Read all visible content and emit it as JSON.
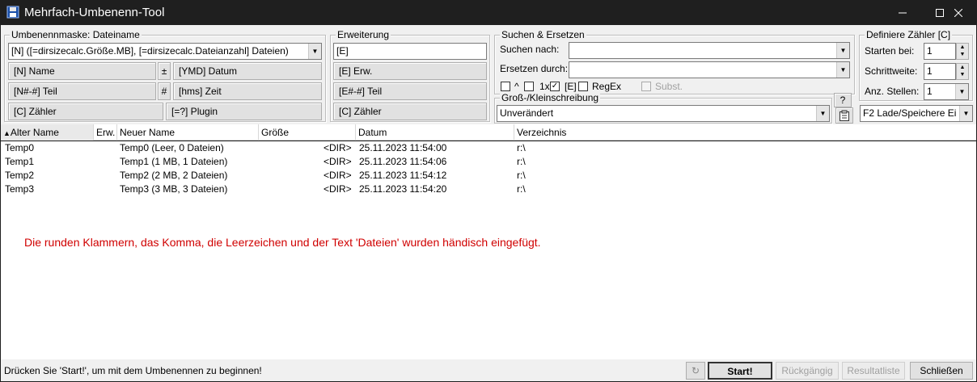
{
  "window": {
    "title": "Mehrfach-Umbenenn-Tool",
    "minimize": "—",
    "maximize": "☐",
    "close": "✕"
  },
  "mask": {
    "legend": "Umbenennmaske: Dateiname",
    "value": "[N] ([=dirsizecalc.Größe.MB], [=dirsizecalc.Dateianzahl] Dateien)",
    "btn_name": "[N]  Name",
    "btn_plusminus": "±",
    "btn_date": "[YMD]  Datum",
    "btn_part": "[N#-#] Teil",
    "btn_hash": "#",
    "btn_time": "[hms]  Zeit",
    "btn_counter": "[C]  Zähler",
    "btn_plugin": "[=?]  Plugin"
  },
  "extension": {
    "legend": "Erweiterung",
    "value": "[E]",
    "btn_ext": "[E]  Erw.",
    "btn_part": "[E#-#] Teil",
    "btn_counter": "[C]  Zähler"
  },
  "search": {
    "legend": "Suchen & Ersetzen",
    "find_label": "Suchen nach:",
    "find_value": "",
    "replace_label": "Ersetzen durch:",
    "replace_value": "",
    "opt_caret": "^",
    "opt_once": "1x",
    "opt_ext": "[E]",
    "opt_regex": "RegEx",
    "opt_subst": "Subst.",
    "help_btn": "?"
  },
  "case": {
    "legend": "Groß-/Kleinschreibung",
    "value": "Unverändert"
  },
  "counter": {
    "legend": "Definiere Zähler [C]",
    "start_label": "Starten bei:",
    "start_value": "1",
    "step_label": "Schrittweite:",
    "step_value": "1",
    "digits_label": "Anz. Stellen:",
    "digits_value": "1",
    "load_save": "F2 Lade/Speichere Ei"
  },
  "columns": [
    "Alter Name",
    "Erw.",
    "Neuer Name",
    "Größe",
    "Datum",
    "Verzeichnis"
  ],
  "rows": [
    {
      "old": "Temp0",
      "ext": "",
      "new": "Temp0 (Leer, 0 Dateien)",
      "size": "<DIR>",
      "date": "25.11.2023 11:54:00",
      "dir": "r:\\"
    },
    {
      "old": "Temp1",
      "ext": "",
      "new": "Temp1 (1 MB, 1 Dateien)",
      "size": "<DIR>",
      "date": "25.11.2023 11:54:06",
      "dir": "r:\\"
    },
    {
      "old": "Temp2",
      "ext": "",
      "new": "Temp2 (2 MB, 2 Dateien)",
      "size": "<DIR>",
      "date": "25.11.2023 11:54:12",
      "dir": "r:\\"
    },
    {
      "old": "Temp3",
      "ext": "",
      "new": "Temp3 (3 MB, 3 Dateien)",
      "size": "<DIR>",
      "date": "25.11.2023 11:54:20",
      "dir": "r:\\"
    }
  ],
  "note": "Die runden Klammern, das Komma, die Leerzeichen und der Text 'Dateien' wurden händisch eingefügt.",
  "status": {
    "text": "Drücken Sie 'Start!', um mit dem Umbenennen zu beginnen!",
    "start": "Start!",
    "undo": "Rückgängig",
    "results": "Resultatliste",
    "close": "Schließen"
  },
  "colors": {
    "note": "#d00000",
    "titlebar": "#1f1f1f",
    "panel": "#f0f0f0"
  }
}
